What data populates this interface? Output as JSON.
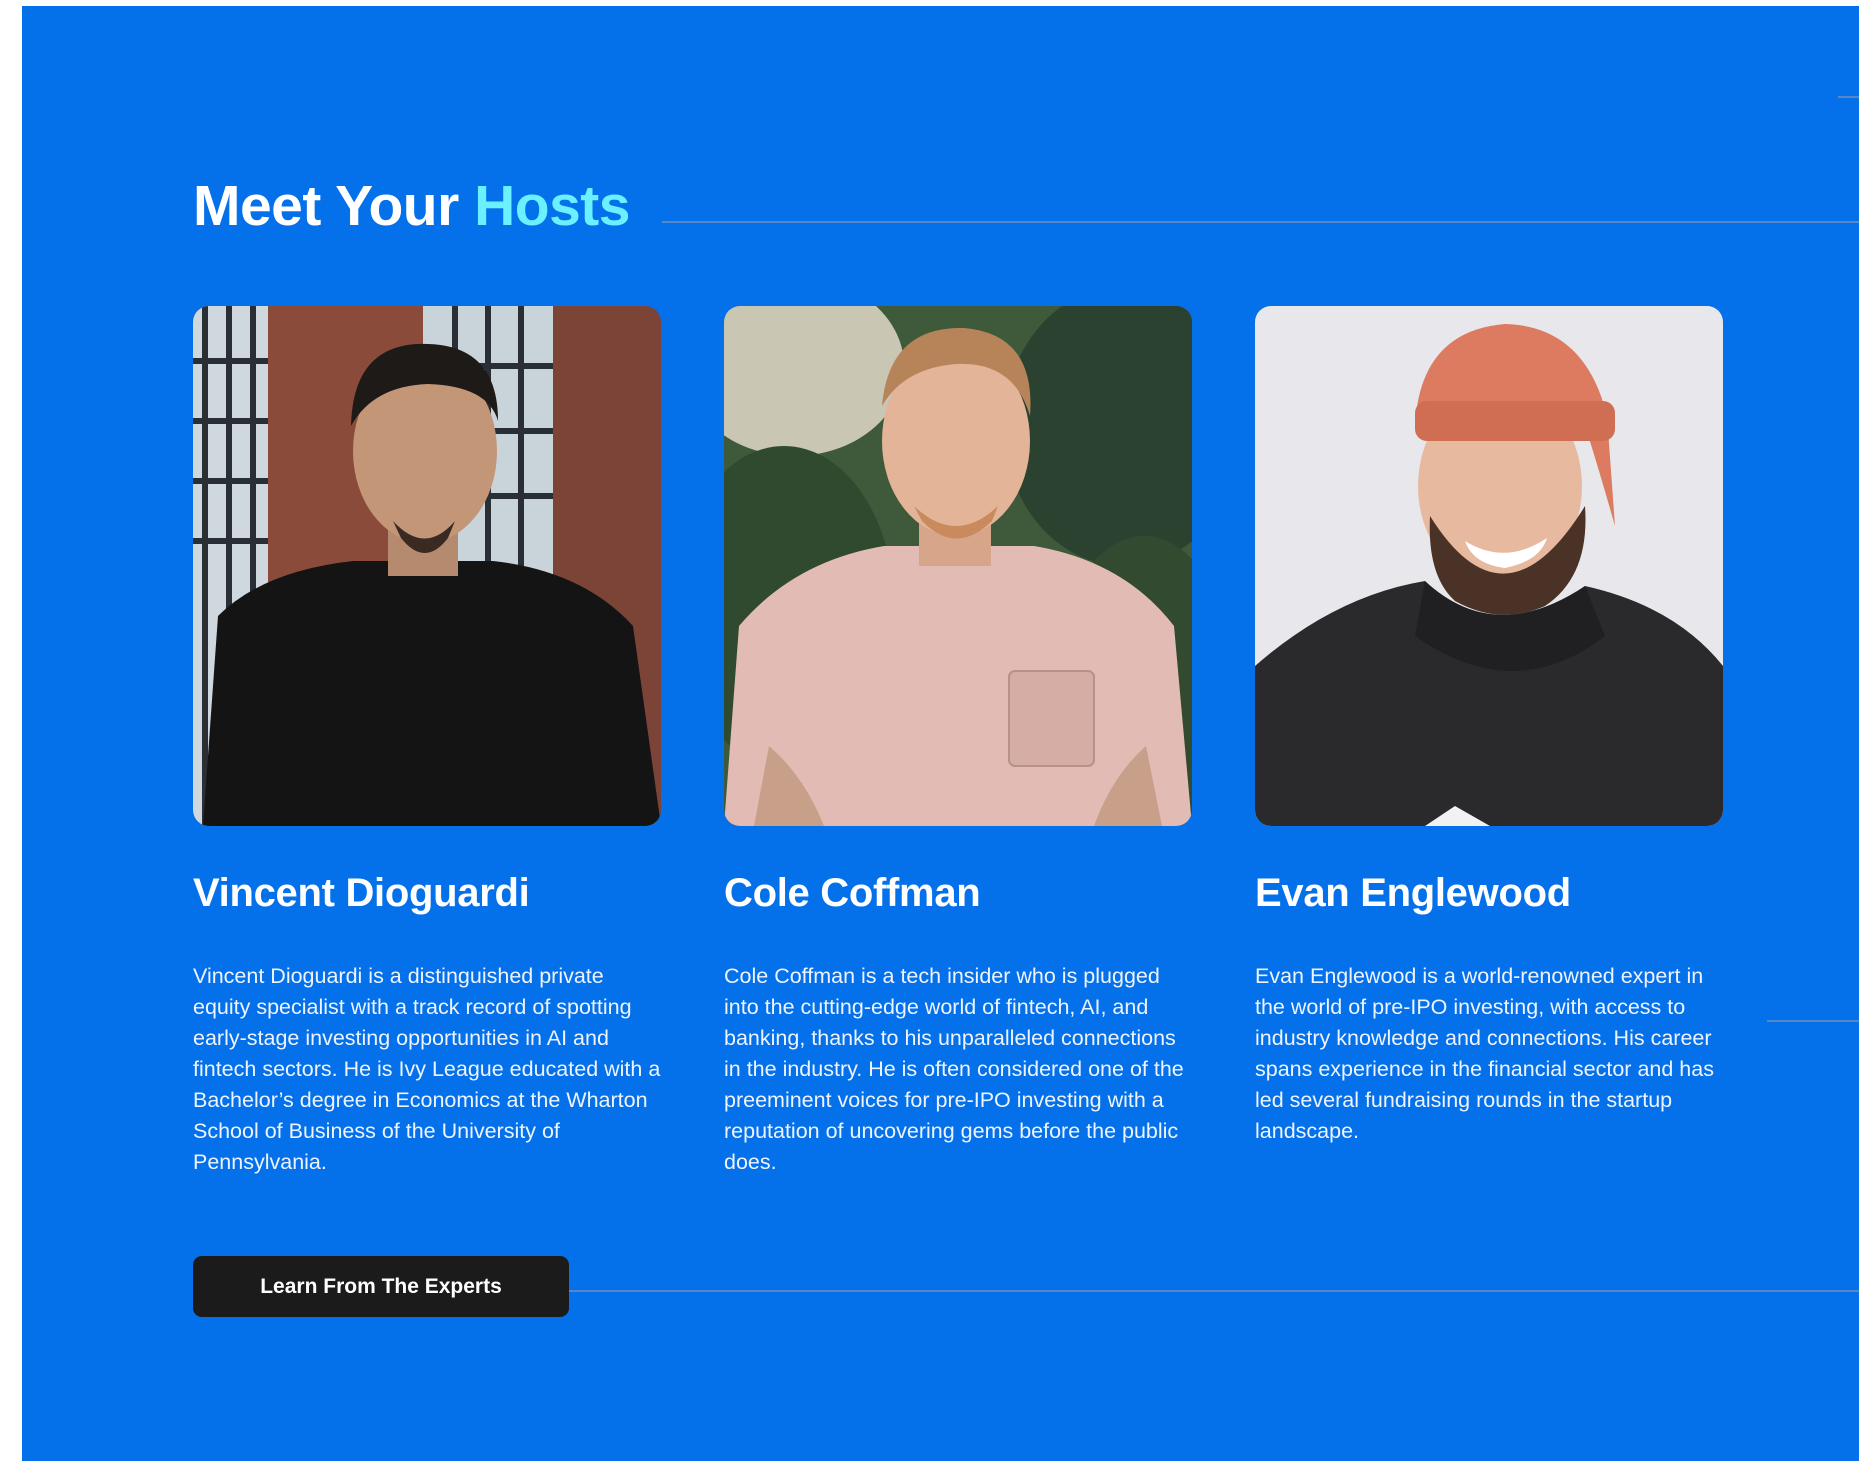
{
  "section": {
    "title_prefix": "Meet Your",
    "title_accent": "Hosts",
    "accent_color": "#6af0ff",
    "background_color": "#0470ea"
  },
  "hosts": [
    {
      "name": "Vincent Dioguardi",
      "bio": "Vincent Dioguardi is a distinguished private equity specialist with a track record of spotting early-stage investing opportunities in AI and fintech sectors. He is Ivy League educated with a Bachelor’s degree in Economics at the Wharton School of Business of the University of Pennsylvania."
    },
    {
      "name": "Cole Coffman",
      "bio": "Cole Coffman is a tech insider who is plugged into the cutting-edge world of fintech, AI, and banking, thanks to his unparalleled connections in the industry. He is often considered one of the preeminent voices for pre-IPO investing with a reputation of uncovering gems before the public does."
    },
    {
      "name": "Evan Englewood",
      "bio": "Evan Englewood is a world-renowned expert in the world of pre-IPO investing, with access to industry knowledge and connections. His career spans experience in the financial sector and has led several fundraising rounds in the startup landscape."
    }
  ],
  "cta": {
    "label": "Learn From The Experts"
  }
}
